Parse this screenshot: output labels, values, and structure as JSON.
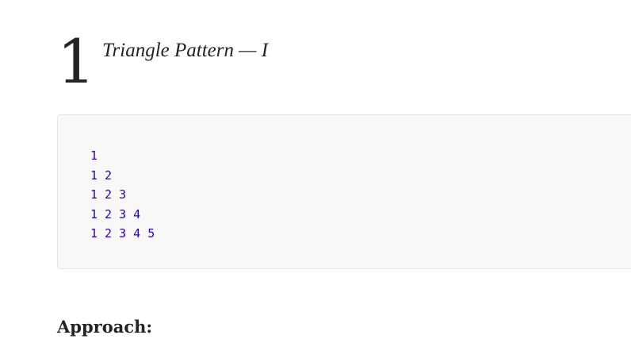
{
  "section": {
    "number": "1",
    "title": "Triangle Pattern — I"
  },
  "code_block": {
    "lines": [
      "1",
      "1 2",
      "1 2 3",
      "1 2 3 4",
      "1 2 3 4 5"
    ],
    "text_color": "#2a00b8",
    "background_color": "#f8f8f8"
  },
  "approach_heading": "Approach:"
}
